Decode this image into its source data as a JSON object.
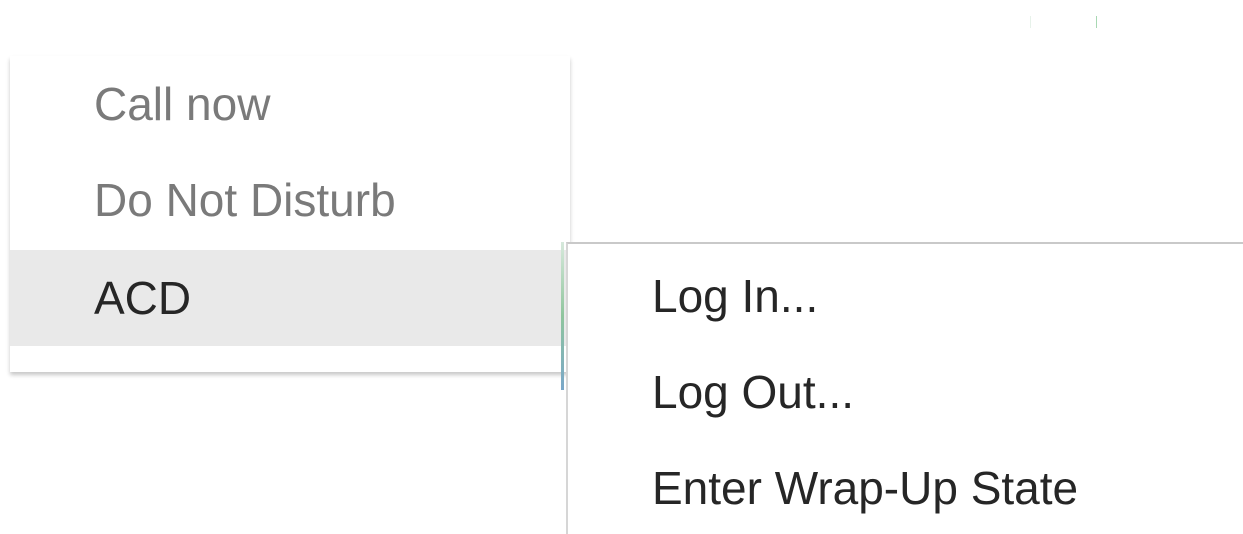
{
  "context_menu": {
    "items": [
      {
        "label": "Call now",
        "enabled": false
      },
      {
        "label": "Do Not Disturb",
        "enabled": false
      },
      {
        "label": "ACD",
        "enabled": true,
        "highlighted": true,
        "has_submenu": true
      }
    ]
  },
  "acd_submenu": {
    "items": [
      {
        "label": "Log In..."
      },
      {
        "label": "Log Out..."
      },
      {
        "label": "Enter Wrap-Up State"
      }
    ]
  },
  "colors": {
    "highlight_background": "#e9e9e9",
    "disabled_text": "#7a7a7a",
    "enabled_text": "#262626",
    "submenu_accent": "#8fc59d"
  }
}
